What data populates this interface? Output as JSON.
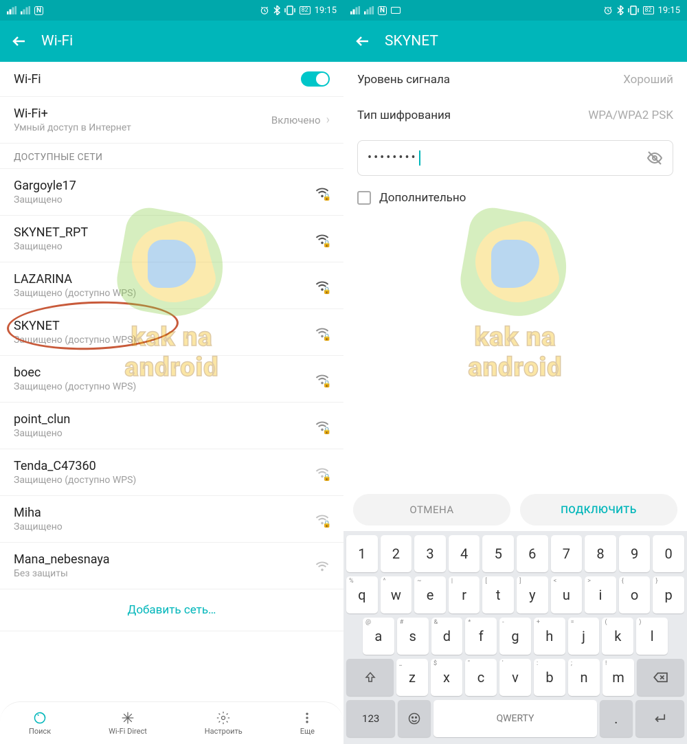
{
  "status": {
    "time": "19:15",
    "battery": "82"
  },
  "left": {
    "title": "Wi-Fi",
    "wifi_label": "Wi-Fi",
    "wifi_plus": {
      "title": "Wi-Fi+",
      "sub": "Умный доступ в Интернет",
      "value": "Включено"
    },
    "section": "ДОСТУПНЫЕ СЕТИ",
    "networks": [
      {
        "name": "Gargoyle17",
        "sub": "Защищено",
        "signal": "strong",
        "locked": true
      },
      {
        "name": "SKYNET_RPT",
        "sub": "Защищено",
        "signal": "strong",
        "locked": true
      },
      {
        "name": "LAZARINA",
        "sub": "Защищено (доступно WPS)",
        "signal": "strong",
        "locked": true
      },
      {
        "name": "SKYNET",
        "sub": "Защищено (доступно WPS)",
        "signal": "mid",
        "locked": true
      },
      {
        "name": "boec",
        "sub": "Защищено (доступно WPS)",
        "signal": "mid",
        "locked": true
      },
      {
        "name": "point_clun",
        "sub": "Защищено",
        "signal": "mid",
        "locked": true
      },
      {
        "name": "Tenda_C47360",
        "sub": "Защищено (доступно WPS)",
        "signal": "weak",
        "locked": true
      },
      {
        "name": "Miha",
        "sub": "Защищено",
        "signal": "weak",
        "locked": true
      },
      {
        "name": "Mana_nebesnaya",
        "sub": "Без защиты",
        "signal": "weak",
        "locked": false
      }
    ],
    "add_network": "Добавить сеть…",
    "bottom": [
      {
        "label": "Поиск",
        "icon": "refresh"
      },
      {
        "label": "Wi-Fi Direct",
        "icon": "direct"
      },
      {
        "label": "Настроить",
        "icon": "gear"
      },
      {
        "label": "Еще",
        "icon": "more"
      }
    ]
  },
  "right": {
    "title": "SKYNET",
    "signal_label": "Уровень сигнала",
    "signal_value": "Хороший",
    "enc_label": "Тип шифрования",
    "enc_value": "WPA/WPA2 PSK",
    "password_mask": "••••••••",
    "advanced": "Дополнительно",
    "cancel": "ОТМЕНА",
    "connect": "ПОДКЛЮЧИТЬ",
    "keyboard": {
      "row_num": [
        "1",
        "2",
        "3",
        "4",
        "5",
        "6",
        "7",
        "8",
        "9",
        "0"
      ],
      "row_q_hints": [
        "%",
        "^",
        "~",
        "|",
        "[",
        "]",
        "<",
        ">",
        "{",
        "}"
      ],
      "row_q": [
        "q",
        "w",
        "e",
        "r",
        "t",
        "y",
        "u",
        "i",
        "o",
        "p"
      ],
      "row_a_hints": [
        "@",
        "#",
        "&",
        "*",
        "-",
        "+",
        "=",
        "(",
        ")"
      ],
      "row_a": [
        "a",
        "s",
        "d",
        "f",
        "g",
        "h",
        "j",
        "k",
        "l"
      ],
      "row_z_hints": [
        "_",
        "$",
        "\"",
        "'",
        ":",
        ";",
        "!",
        "?"
      ],
      "row_z": [
        "z",
        "x",
        "c",
        "v",
        "b",
        "n",
        "m"
      ],
      "mode": "123",
      "space": "QWERTY"
    }
  },
  "watermark": {
    "line1": "kak na",
    "line2": "android"
  }
}
